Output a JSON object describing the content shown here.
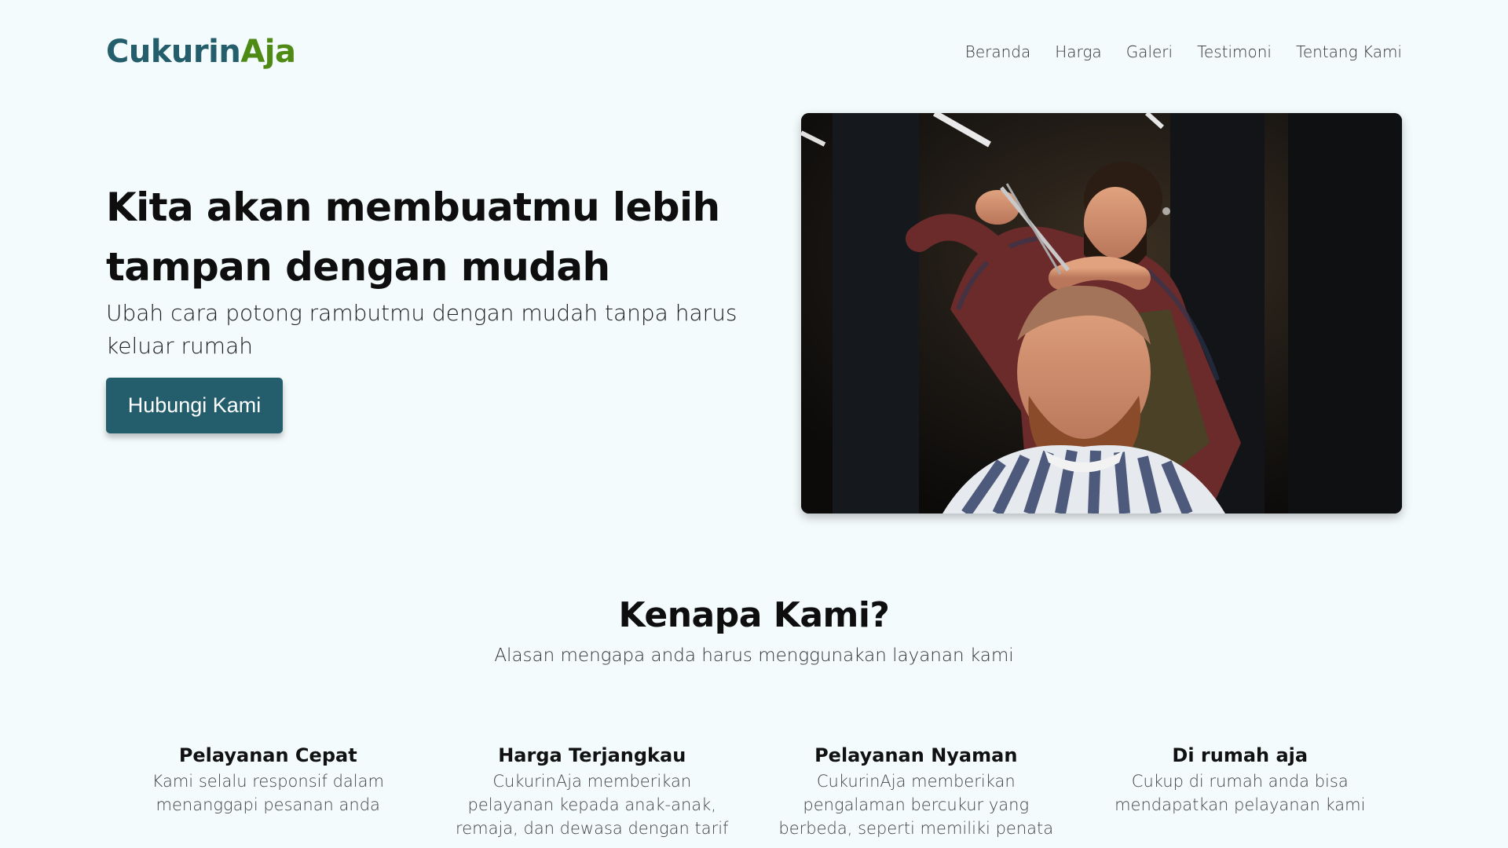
{
  "brand": {
    "part1": "Cukurin",
    "part2": "Aja"
  },
  "nav": {
    "items": [
      {
        "label": "Beranda"
      },
      {
        "label": "Harga"
      },
      {
        "label": "Galeri"
      },
      {
        "label": "Testimoni"
      },
      {
        "label": "Tentang Kami"
      }
    ]
  },
  "hero": {
    "title": "Kita akan membuatmu lebih tampan dengan mudah",
    "subtitle": "Ubah cara potong rambutmu dengan mudah tanpa harus keluar rumah",
    "cta_label": "Hubungi Kami"
  },
  "why": {
    "title": "Kenapa Kami?",
    "subtitle": "Alasan mengapa anda harus menggunakan layanan kami",
    "features": [
      {
        "title": "Pelayanan Cepat",
        "desc": "Kami selalu responsif dalam menanggapi pesanan anda"
      },
      {
        "title": "Harga Terjangkau",
        "desc": "CukurinAja memberikan pelayanan kepada anak-anak, remaja, dan dewasa dengan tarif"
      },
      {
        "title": "Pelayanan Nyaman",
        "desc": "CukurinAja memberikan pengalaman bercukur yang berbeda, seperti memiliki penata"
      },
      {
        "title": "Di rumah aja",
        "desc": "Cukup di rumah anda bisa mendapatkan pelayanan kami"
      }
    ]
  },
  "colors": {
    "brand_teal": "#245e6c",
    "brand_green": "#4f8a14",
    "background": "#f3fbfc"
  }
}
